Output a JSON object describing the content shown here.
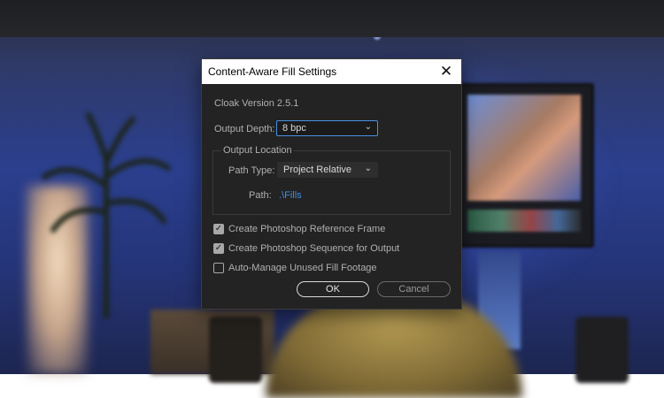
{
  "dialog": {
    "title": "Content-Aware Fill Settings",
    "close_glyph": "✕",
    "version_text": "Cloak Version 2.5.1",
    "output_depth": {
      "label": "Output Depth:",
      "selected": "8 bpc"
    },
    "output_location": {
      "group_title": "Output Location",
      "path_type": {
        "label": "Path Type:",
        "selected": "Project Relative"
      },
      "path": {
        "label": "Path:",
        "value": ".\\Fills"
      }
    },
    "checkboxes": [
      {
        "label": "Create Photoshop Reference Frame",
        "checked": true
      },
      {
        "label": "Create Photoshop Sequence for Output",
        "checked": true
      },
      {
        "label": "Auto-Manage Unused Fill Footage",
        "checked": false
      }
    ],
    "buttons": {
      "ok": "OK",
      "cancel": "Cancel"
    }
  },
  "icons": {
    "close": "close-icon",
    "dropdown": "chevron-down-icon",
    "check": "checkmark-icon"
  },
  "colors": {
    "dialog_bg": "#232323",
    "title_bg": "#ffffff",
    "link": "#3d8ee6",
    "focus": "#4a90e2"
  }
}
